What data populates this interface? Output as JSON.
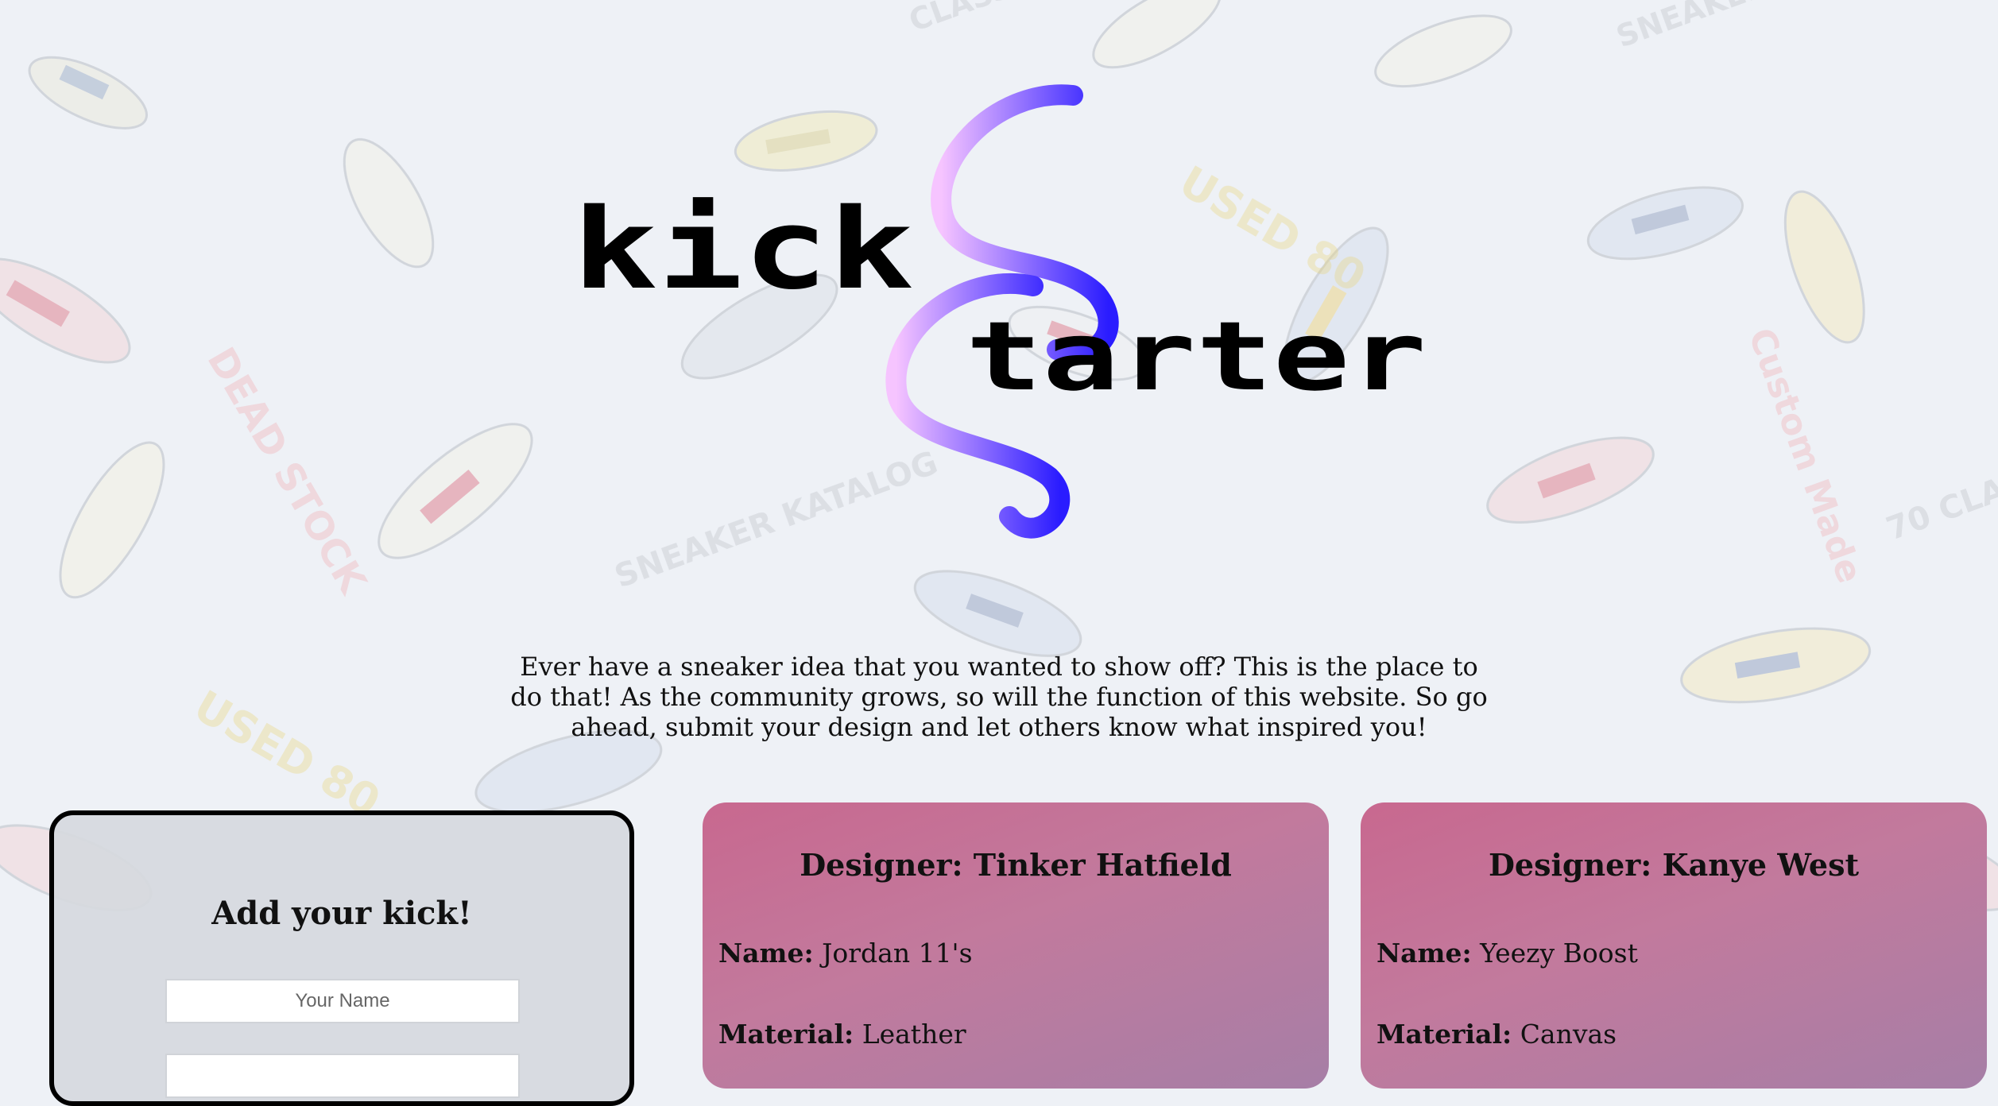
{
  "logo": {
    "word1": "kick",
    "word2": "tarter"
  },
  "intro": {
    "text": "Ever have a sneaker idea that you wanted to show off? This is the place to do that! As the community grows, so will the function of this website. So go ahead, submit your design and let others know what inspired you!"
  },
  "add_kick": {
    "title": "Add your kick!",
    "name_placeholder": "Your Name",
    "second_placeholder": ""
  },
  "cards": [
    {
      "designer": "Designer: Tinker Hatfield",
      "name_label": "Name:",
      "name_value": "Jordan 11's",
      "material_label": "Material:",
      "material_value": "Leather"
    },
    {
      "designer": "Designer: Kanye West",
      "name_label": "Name:",
      "name_value": "Yeezy Boost",
      "material_label": "Material:",
      "material_value": "Canvas"
    }
  ],
  "colors": {
    "background": "#eef1f6",
    "card_gradient_start": "#c8688f",
    "card_gradient_end": "#a67ea6",
    "logo_swirl_light": "#f4b6ff",
    "logo_swirl_dark": "#2a1cff",
    "panel_border": "#000000"
  },
  "icons": [
    "sneaker-pattern-background",
    "s-swirl-logo-mark"
  ]
}
